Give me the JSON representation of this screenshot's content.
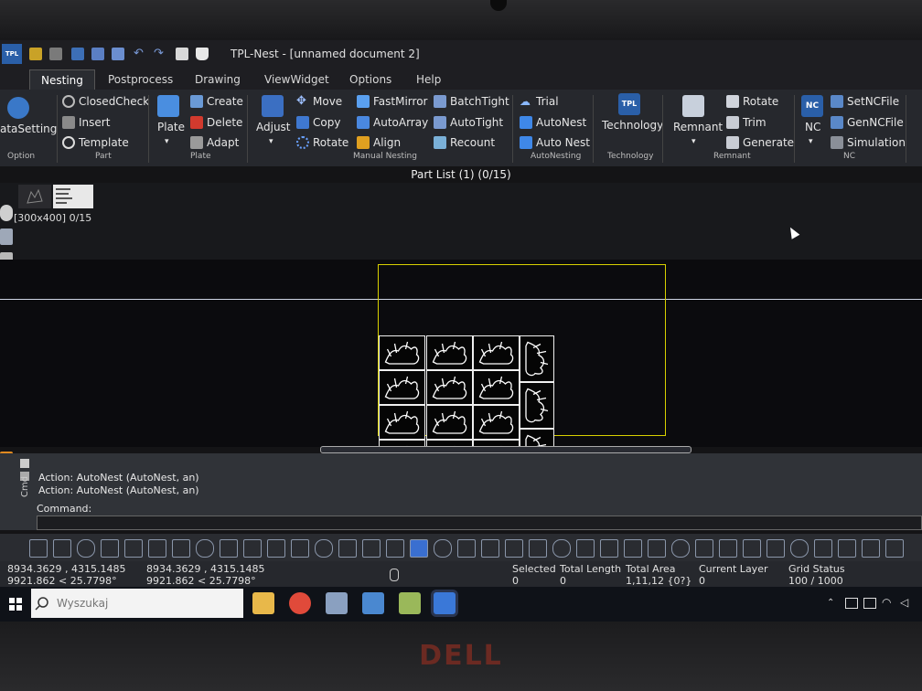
{
  "window": {
    "title": "TPL-Nest - [unnamed document 2]",
    "logo": "TPL"
  },
  "tabs": [
    {
      "label": "Nesting",
      "active": true
    },
    {
      "label": "Postprocess"
    },
    {
      "label": "Drawing"
    },
    {
      "label": "ViewWidget"
    },
    {
      "label": "Options"
    },
    {
      "label": "Help"
    }
  ],
  "ribbon": {
    "option": {
      "data_setting": "ataSetting",
      "group": "Option"
    },
    "part": {
      "closed_check": "ClosedCheck",
      "insert": "Insert",
      "template": "Template",
      "group": "Part"
    },
    "plate": {
      "plate": "Plate",
      "create": "Create",
      "delete": "Delete",
      "adapt": "Adapt",
      "group": "Plate"
    },
    "manual": {
      "adjust": "Adjust",
      "move": "Move",
      "copy": "Copy",
      "rotate": "Rotate",
      "fast_mirror": "FastMirror",
      "auto_array": "AutoArray",
      "align": "Align",
      "batch_tight": "BatchTight",
      "auto_tight": "AutoTight",
      "recount": "Recount",
      "group": "Manual Nesting"
    },
    "autonest": {
      "trial": "Trial",
      "autonest": "AutoNest",
      "auto_nest": "Auto Nest",
      "group": "AutoNesting"
    },
    "technology": {
      "badge": "TPL",
      "label": "Technology",
      "group": "Technology"
    },
    "remnant": {
      "remnant": "Remnant",
      "rotate": "Rotate",
      "trim": "Trim",
      "generate": "Generate",
      "group": "Remnant"
    },
    "nc": {
      "nc": "NC",
      "nc_badge": "NC",
      "set_nc_file": "SetNCFile",
      "gen_nc_file": "GenNCFile",
      "simulation": "Simulation",
      "group": "NC"
    }
  },
  "part_list": {
    "title": "Part List (1) (0/15)",
    "thumb_caption": "[300x400] 0/15"
  },
  "log": {
    "lines": [
      "Action: AutoNest (AutoNest, an)",
      "Action: AutoNest (AutoNest, an)"
    ],
    "command_label": "Command:",
    "command_value": "",
    "side_label": "Cmd"
  },
  "status": {
    "coord_a1": "8934.3629 , 4315.1485",
    "coord_a2": "9921.862 < 25.7798°",
    "coord_b1": "8934.3629 , 4315.1485",
    "coord_b2": "9921.862 < 25.7798°",
    "selected_label": "Selected",
    "selected_value": "0",
    "total_length_label": "Total Length",
    "total_length_value": "0",
    "total_area_label": "Total Area",
    "total_area_value": "1,11,12 {0?}",
    "current_layer_label": "Current Layer",
    "current_layer_value": "0",
    "grid_status_label": "Grid Status",
    "grid_status_value": "100 / 1000"
  },
  "taskbar": {
    "search_placeholder": "Wyszukaj"
  },
  "bezel": {
    "brand": "DELL"
  },
  "colors": {
    "plate_border": "#d8d000",
    "part_outline": "#f0f0f0",
    "ribbon_bg": "#26282d",
    "accent": "#2a5fa8"
  }
}
